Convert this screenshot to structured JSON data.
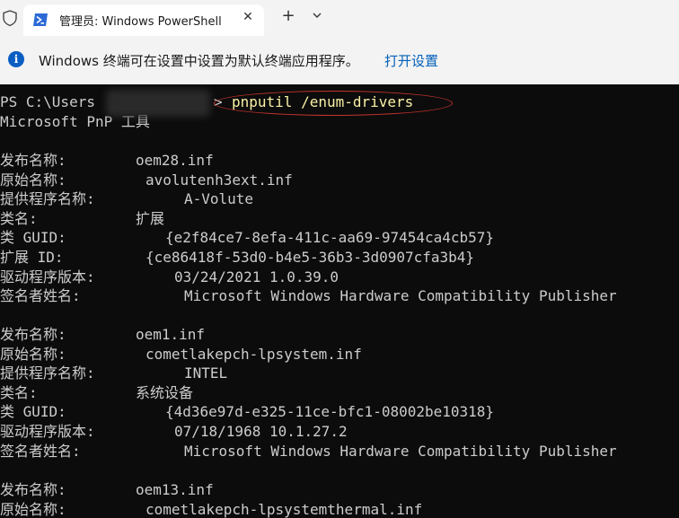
{
  "window": {
    "tab_title": "管理员: Windows PowerShell",
    "close_glyph": "✕",
    "new_tab_glyph": "+"
  },
  "infobar": {
    "message": "Windows 终端可在设置中设置为默认终端应用程序。",
    "link": "打开设置"
  },
  "terminal": {
    "prompt": "PS C:\\Users",
    "prompt_end": ">",
    "command": "pnputil /enum-drivers",
    "tool_name": "Microsoft PnP 工具",
    "drivers": [
      {
        "entries": [
          {
            "label": "发布名称:",
            "value": "oem28.inf"
          },
          {
            "label": "原始名称:",
            "value": "avolutenh3ext.inf"
          },
          {
            "label": "提供程序名称:",
            "value": "A-Volute"
          },
          {
            "label": "类名:",
            "value": "扩展"
          },
          {
            "label": "类 GUID:",
            "value": "{e2f84ce7-8efa-411c-aa69-97454ca4cb57}"
          },
          {
            "label": "扩展 ID:",
            "value": "{ce86418f-53d0-b4e5-36b3-3d0907cfa3b4}"
          },
          {
            "label": "驱动程序版本:",
            "value": "03/24/2021 1.0.39.0"
          },
          {
            "label": "签名者姓名:",
            "value": "Microsoft Windows Hardware Compatibility Publisher"
          }
        ]
      },
      {
        "entries": [
          {
            "label": "发布名称:",
            "value": "oem1.inf"
          },
          {
            "label": "原始名称:",
            "value": "cometlakepch-lpsystem.inf"
          },
          {
            "label": "提供程序名称:",
            "value": "INTEL"
          },
          {
            "label": "类名:",
            "value": "系统设备"
          },
          {
            "label": "类 GUID:",
            "value": "{4d36e97d-e325-11ce-bfc1-08002be10318}"
          },
          {
            "label": "驱动程序版本:",
            "value": "07/18/1968 10.1.27.2"
          },
          {
            "label": "签名者姓名:",
            "value": "Microsoft Windows Hardware Compatibility Publisher"
          }
        ]
      },
      {
        "entries": [
          {
            "label": "发布名称:",
            "value": "oem13.inf"
          },
          {
            "label": "原始名称:",
            "value": "cometlakepch-lpsystemthermal.inf"
          }
        ]
      }
    ]
  }
}
